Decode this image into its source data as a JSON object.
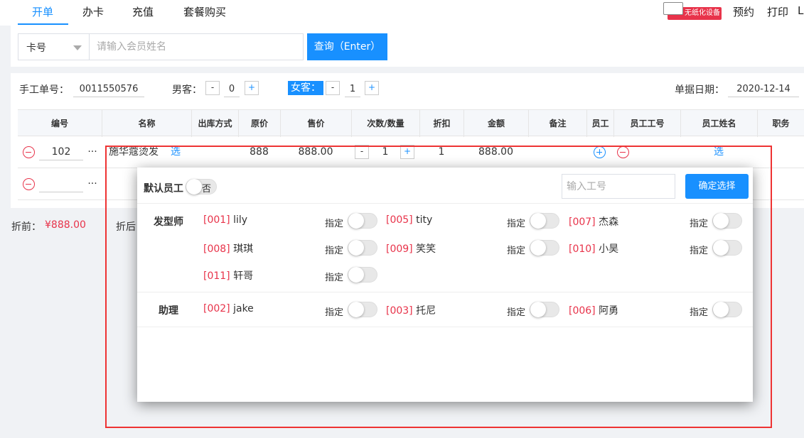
{
  "nav": {
    "tabs": [
      "开单",
      "办卡",
      "充值",
      "套餐购买"
    ],
    "device_label": "无纸化设备",
    "right_actions": [
      "预约",
      "打印",
      "L"
    ]
  },
  "search": {
    "card_select": "卡号",
    "placeholder": "请输入会员姓名",
    "query_button": "查询（Enter）"
  },
  "order": {
    "manual_no_label": "手工单号：",
    "manual_no": "0011550576",
    "male_label": "男客：",
    "male_count": "0",
    "female_label": "女客：",
    "female_count": "1",
    "date_label": "单据日期：",
    "date": "2020-12-14",
    "minus": "-",
    "plus": "+"
  },
  "table": {
    "headers": [
      "编号",
      "名称",
      "出库方式",
      "原价",
      "售价",
      "次数/数量",
      "折扣",
      "金额",
      "备注",
      "员工",
      "员工工号",
      "员工姓名",
      "职务"
    ],
    "rows": [
      {
        "code": "102",
        "more": "...",
        "name": "施华蔻烫发",
        "select": "选",
        "original": "888",
        "price": "888.00",
        "qty": "1",
        "discount": "1",
        "amount": "888.00",
        "staff_select": "选"
      },
      {
        "code": "",
        "more": "..."
      }
    ]
  },
  "totals": {
    "before_label": "折前：",
    "before_value": "¥888.00",
    "after_label": "折后"
  },
  "popup": {
    "default_label": "默认员工",
    "default_toggle": "否",
    "code_placeholder": "输入工号",
    "confirm": "确定选择",
    "assign_label": "指定",
    "sections": [
      {
        "title": "发型师",
        "staff": [
          {
            "code": "[001]",
            "name": "lily"
          },
          {
            "code": "[005]",
            "name": "tity"
          },
          {
            "code": "[007]",
            "name": "杰森"
          },
          {
            "code": "[008]",
            "name": "琪琪"
          },
          {
            "code": "[009]",
            "name": "笑笑"
          },
          {
            "code": "[010]",
            "name": "小昊"
          },
          {
            "code": "[011]",
            "name": "轩哥"
          }
        ]
      },
      {
        "title": "助理",
        "staff": [
          {
            "code": "[002]",
            "name": "jake"
          },
          {
            "code": "[003]",
            "name": "托尼"
          },
          {
            "code": "[006]",
            "name": "阿勇"
          }
        ]
      }
    ]
  }
}
